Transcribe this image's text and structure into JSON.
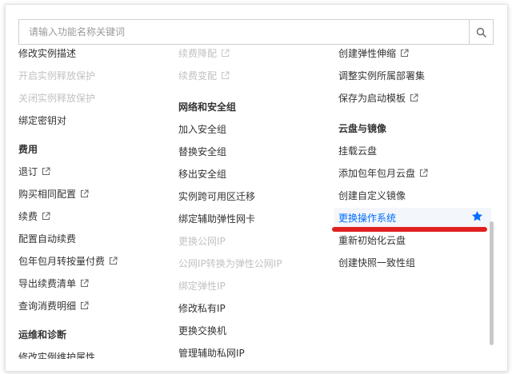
{
  "search": {
    "placeholder": "请输入功能名称关键词",
    "value": ""
  },
  "colors": {
    "accent": "#006eff",
    "disabled": "#c2c2c2",
    "annotation": "#e02020"
  },
  "columns": [
    {
      "items": [
        {
          "label": "修改实例描述",
          "kind": "item"
        },
        {
          "label": "开启实例释放保护",
          "kind": "disabled"
        },
        {
          "label": "关闭实例释放保护",
          "kind": "disabled"
        },
        {
          "label": "绑定密钥对",
          "kind": "item"
        },
        {
          "label": "费用",
          "kind": "heading"
        },
        {
          "label": "退订",
          "kind": "item",
          "external": true
        },
        {
          "label": "购买相同配置",
          "kind": "item",
          "external": true
        },
        {
          "label": "续费",
          "kind": "item",
          "external": true
        },
        {
          "label": "配置自动续费",
          "kind": "item"
        },
        {
          "label": "包年包月转按量付费",
          "kind": "item",
          "external": true
        },
        {
          "label": "导出续费清单",
          "kind": "item",
          "external": true
        },
        {
          "label": "查询消费明细",
          "kind": "item",
          "external": true
        },
        {
          "label": "运维和诊断",
          "kind": "heading"
        },
        {
          "label": "修改实例维护属性",
          "kind": "item"
        }
      ]
    },
    {
      "items": [
        {
          "label": "续费降配",
          "kind": "disabled",
          "external": true
        },
        {
          "label": "续费变配",
          "kind": "disabled",
          "external": true
        },
        {
          "label": "网络和安全组",
          "kind": "heading"
        },
        {
          "label": "加入安全组",
          "kind": "item"
        },
        {
          "label": "替换安全组",
          "kind": "item"
        },
        {
          "label": "移出安全组",
          "kind": "item"
        },
        {
          "label": "实例跨可用区迁移",
          "kind": "item"
        },
        {
          "label": "绑定辅助弹性网卡",
          "kind": "item"
        },
        {
          "label": "更换公网IP",
          "kind": "disabled"
        },
        {
          "label": "公网IP转换为弹性公网IP",
          "kind": "disabled"
        },
        {
          "label": "绑定弹性IP",
          "kind": "disabled"
        },
        {
          "label": "修改私有IP",
          "kind": "item"
        },
        {
          "label": "更换交换机",
          "kind": "item"
        },
        {
          "label": "管理辅助私网IP",
          "kind": "item"
        }
      ]
    },
    {
      "items": [
        {
          "label": "创建弹性伸缩",
          "kind": "item",
          "external": true
        },
        {
          "label": "调整实例所属部署集",
          "kind": "item"
        },
        {
          "label": "保存为启动模板",
          "kind": "item",
          "external": true
        },
        {
          "label": "云盘与镜像",
          "kind": "heading"
        },
        {
          "label": "挂载云盘",
          "kind": "item"
        },
        {
          "label": "添加包年包月云盘",
          "kind": "item",
          "external": true
        },
        {
          "label": "创建自定义镜像",
          "kind": "item"
        },
        {
          "label": "更换操作系统",
          "kind": "active",
          "starred": true
        },
        {
          "label": "重新初始化云盘",
          "kind": "item"
        },
        {
          "label": "创建快照一致性组",
          "kind": "item"
        }
      ]
    }
  ]
}
